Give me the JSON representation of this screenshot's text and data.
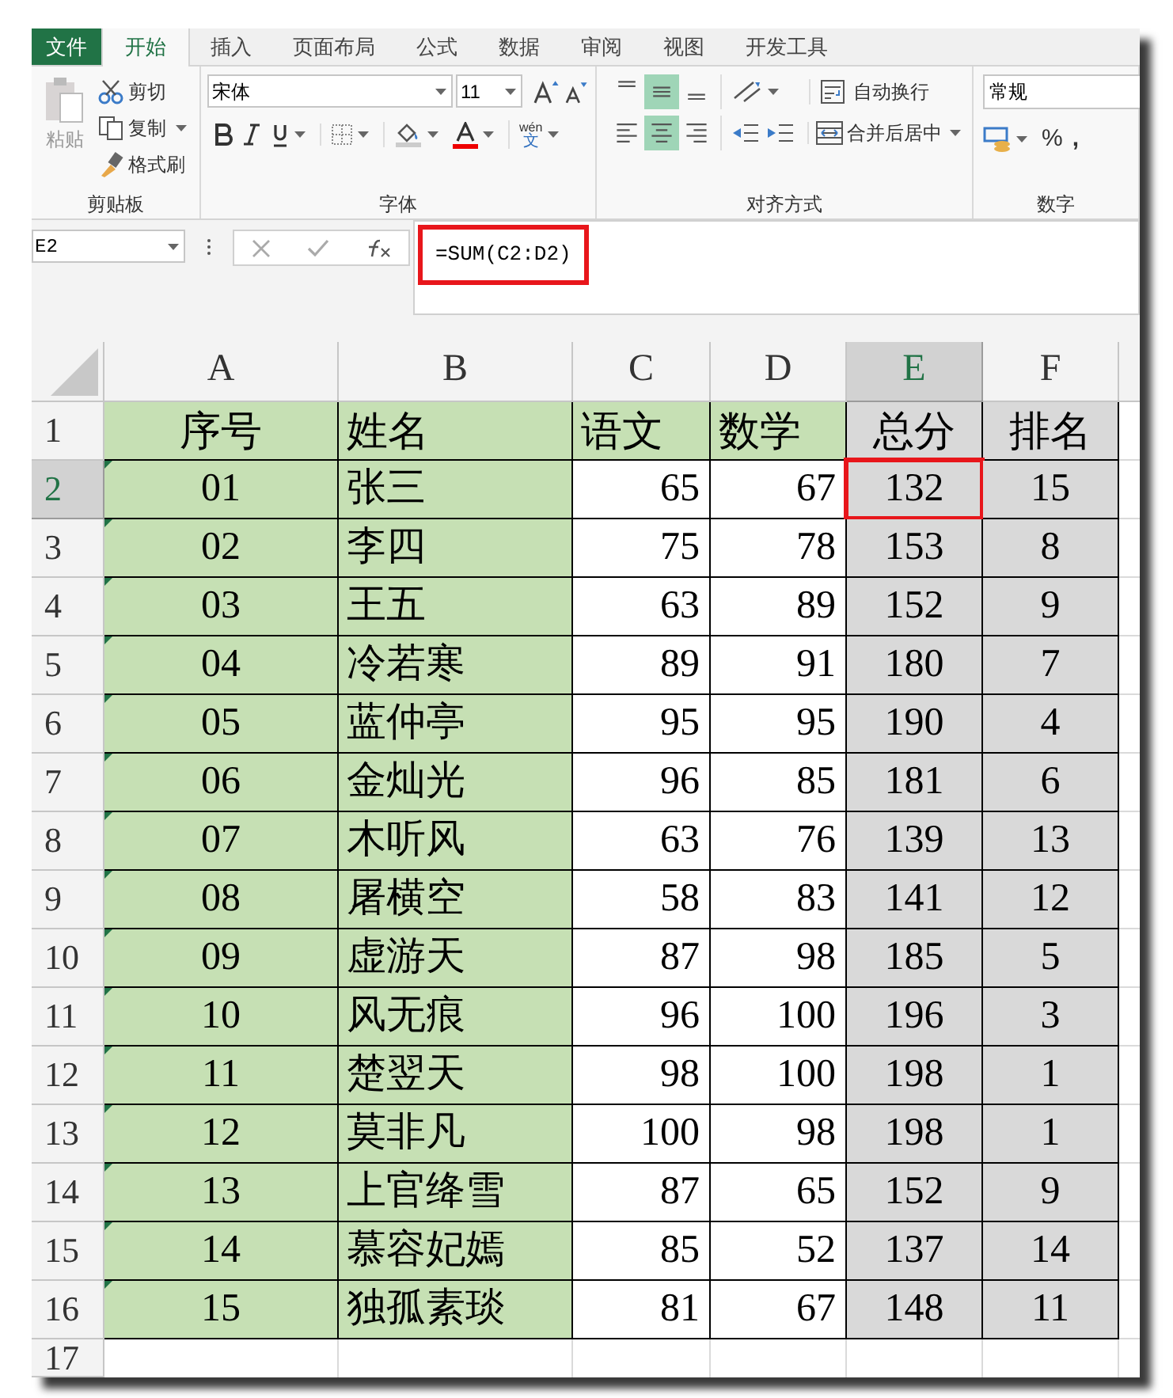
{
  "ribbon_tabs": [
    {
      "label": "文件",
      "kind": "file",
      "selected": false
    },
    {
      "label": "开始",
      "kind": "tab",
      "selected": true
    },
    {
      "label": "插入",
      "kind": "tab",
      "selected": false
    },
    {
      "label": "页面布局",
      "kind": "tab",
      "selected": false
    },
    {
      "label": "公式",
      "kind": "tab",
      "selected": false
    },
    {
      "label": "数据",
      "kind": "tab",
      "selected": false
    },
    {
      "label": "审阅",
      "kind": "tab",
      "selected": false
    },
    {
      "label": "视图",
      "kind": "tab",
      "selected": false
    },
    {
      "label": "开发工具",
      "kind": "tab",
      "selected": false
    }
  ],
  "clipboard": {
    "paste": "粘贴",
    "cut": "剪切",
    "copy": "复制",
    "format_painter": "格式刷",
    "group": "剪贴板"
  },
  "font": {
    "name": "宋体",
    "size": "11",
    "wen_label": "wén",
    "wen_char": "文",
    "group": "字体"
  },
  "alignment": {
    "vertical": [
      {
        "kind": "top",
        "selected": false
      },
      {
        "kind": "middle",
        "selected": true
      },
      {
        "kind": "bottom",
        "selected": false
      }
    ],
    "horizontal": [
      {
        "kind": "left",
        "selected": false
      },
      {
        "kind": "center",
        "selected": true
      },
      {
        "kind": "right",
        "selected": false
      }
    ],
    "wrap": "自动换行",
    "merge": "合并后居中",
    "group": "对齐方式"
  },
  "number": {
    "format": "常规",
    "percent": "%",
    "comma": ",",
    "group": "数字"
  },
  "name_box": "E2",
  "formula": {
    "text": "=SUM(C2:D2)",
    "highlighted": true
  },
  "columns": [
    {
      "label": "A",
      "kind": "id",
      "color": "#c6e0b4",
      "selected": false
    },
    {
      "label": "B",
      "kind": "name",
      "color": "#c6e0b4",
      "selected": false
    },
    {
      "label": "C",
      "kind": "number",
      "color": "#ffffff",
      "selected": false
    },
    {
      "label": "D",
      "kind": "number",
      "color": "#ffffff",
      "selected": false
    },
    {
      "label": "E",
      "kind": "result",
      "color": "#d9d9d9",
      "selected": true
    },
    {
      "label": "F",
      "kind": "result",
      "color": "#d9d9d9",
      "selected": false
    }
  ],
  "header_row": {
    "label": "1",
    "cells": [
      {
        "text": "序号",
        "color": "#c6e0b4"
      },
      {
        "text": "姓名",
        "color": "#c6e0b4"
      },
      {
        "text": "语文",
        "color": "#c6e0b4"
      },
      {
        "text": "数学",
        "color": "#c6e0b4"
      },
      {
        "text": "总分",
        "color": "#d9d9d9"
      },
      {
        "text": "排名",
        "color": "#d9d9d9"
      }
    ]
  },
  "rows": [
    {
      "label": "2",
      "selected": true,
      "cells": [
        "01",
        "张三",
        "65",
        "67",
        "132",
        "15"
      ]
    },
    {
      "label": "3",
      "selected": false,
      "cells": [
        "02",
        "李四",
        "75",
        "78",
        "153",
        "8"
      ]
    },
    {
      "label": "4",
      "selected": false,
      "cells": [
        "03",
        "王五",
        "63",
        "89",
        "152",
        "9"
      ]
    },
    {
      "label": "5",
      "selected": false,
      "cells": [
        "04",
        "冷若寒",
        "89",
        "91",
        "180",
        "7"
      ]
    },
    {
      "label": "6",
      "selected": false,
      "cells": [
        "05",
        "蓝仲亭",
        "95",
        "95",
        "190",
        "4"
      ]
    },
    {
      "label": "7",
      "selected": false,
      "cells": [
        "06",
        "金灿光",
        "96",
        "85",
        "181",
        "6"
      ]
    },
    {
      "label": "8",
      "selected": false,
      "cells": [
        "07",
        "木听风",
        "63",
        "76",
        "139",
        "13"
      ]
    },
    {
      "label": "9",
      "selected": false,
      "cells": [
        "08",
        "屠横空",
        "58",
        "83",
        "141",
        "12"
      ]
    },
    {
      "label": "10",
      "selected": false,
      "cells": [
        "09",
        "虚游天",
        "87",
        "98",
        "185",
        "5"
      ]
    },
    {
      "label": "11",
      "selected": false,
      "cells": [
        "10",
        "风无痕",
        "96",
        "100",
        "196",
        "3"
      ]
    },
    {
      "label": "12",
      "selected": false,
      "cells": [
        "11",
        "楚翌天",
        "98",
        "100",
        "198",
        "1"
      ]
    },
    {
      "label": "13",
      "selected": false,
      "cells": [
        "12",
        "莫非凡",
        "100",
        "98",
        "198",
        "1"
      ]
    },
    {
      "label": "14",
      "selected": false,
      "cells": [
        "13",
        "上官绛雪",
        "87",
        "65",
        "152",
        "9"
      ]
    },
    {
      "label": "15",
      "selected": false,
      "cells": [
        "14",
        "慕容妃嫣",
        "85",
        "52",
        "137",
        "14"
      ]
    },
    {
      "label": "16",
      "selected": false,
      "cells": [
        "15",
        "独孤素琰",
        "81",
        "67",
        "148",
        "11"
      ]
    }
  ],
  "empty_row": {
    "label": "17"
  }
}
